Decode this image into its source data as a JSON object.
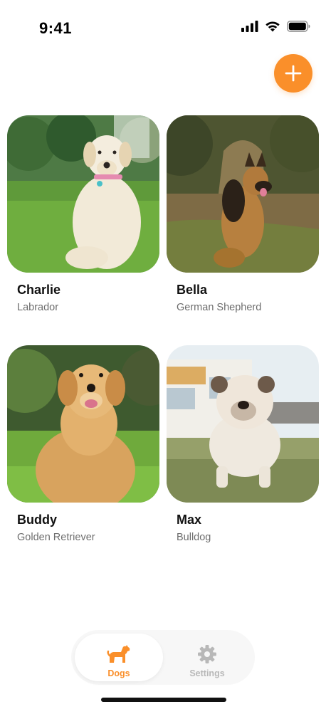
{
  "status_bar": {
    "time": "9:41"
  },
  "header": {
    "add_icon": "plus-icon"
  },
  "dogs": [
    {
      "name": "Charlie",
      "breed": "Labrador"
    },
    {
      "name": "Bella",
      "breed": "German Shepherd"
    },
    {
      "name": "Buddy",
      "breed": "Golden Retriever"
    },
    {
      "name": "Max",
      "breed": "Bulldog"
    }
  ],
  "tab_bar": {
    "tabs": [
      {
        "label": "Dogs",
        "icon": "dog-icon",
        "active": true
      },
      {
        "label": "Settings",
        "icon": "gear-icon",
        "active": false
      }
    ]
  },
  "colors": {
    "accent": "#FA8F2A",
    "inactive": "#B8B8B8",
    "secondary_text": "#6D6D6D"
  }
}
